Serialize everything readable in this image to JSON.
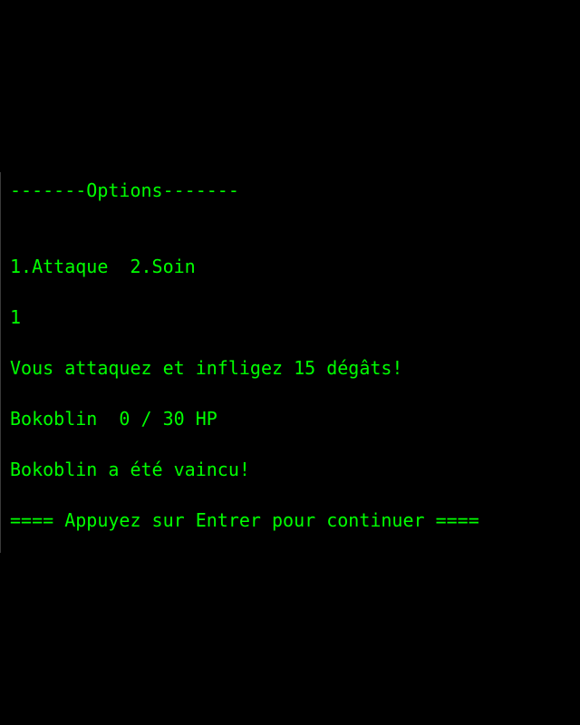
{
  "colors": {
    "background": "#000000",
    "text": "#00ff00"
  },
  "terminal": {
    "options_header": "-------Options-------",
    "menu": "1.Attaque  2.Soin",
    "input": "1",
    "attack_message": "Vous attaquez et infligez 15 dégâts!",
    "enemy_status": "Bokoblin  0 / 30 HP",
    "defeat_message": "Bokoblin a été vaincu!",
    "continue_prompt": "==== Appuyez sur Entrer pour continuer ===="
  }
}
